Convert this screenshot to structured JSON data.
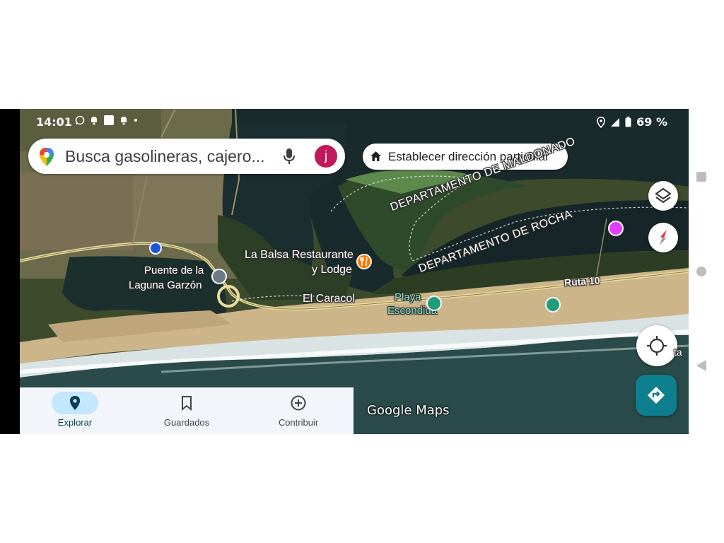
{
  "status_bar": {
    "time": "14:01",
    "battery": "69 %"
  },
  "search": {
    "placeholder": "Busca gasolineras, cajero...",
    "avatar_initial": "j"
  },
  "home_chip": {
    "label": "Establecer dirección particular"
  },
  "map_labels": {
    "dept_maldonado": "DEPARTAMENTO DE MALDONADO",
    "dept_rocha": "DEPARTAMENTO DE ROCHA",
    "restaurant_line1": "La Balsa Restaurante",
    "restaurant_line2": "y Lodge",
    "bridge_line1": "Puente de la",
    "bridge_line2": "Laguna Garzón",
    "place": "El Caracol",
    "beach_line1": "Playa",
    "beach_line2": "Escondida",
    "road": "Ruta 10",
    "partial": "ta"
  },
  "bottom_nav": {
    "items": [
      {
        "label": "Explorar",
        "icon": "location-pin-icon",
        "active": true
      },
      {
        "label": "Guardados",
        "icon": "bookmark-icon",
        "active": false
      },
      {
        "label": "Contribuir",
        "icon": "add-circle-icon",
        "active": false
      }
    ]
  },
  "watermark": "Google Maps",
  "colors": {
    "accent_teal": "#0d7f8e",
    "avatar": "#c2185b",
    "nav_active_pill": "#c2e7ff",
    "location_dot": "#1a56db"
  }
}
